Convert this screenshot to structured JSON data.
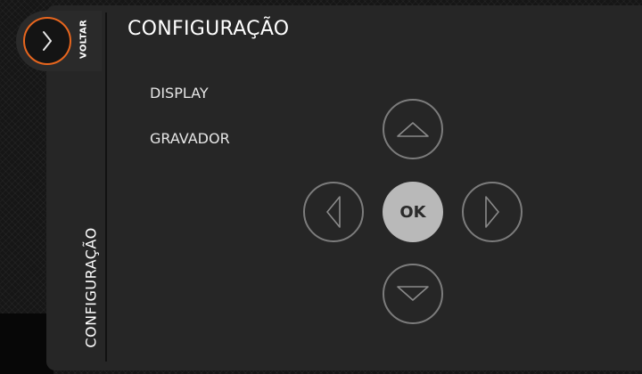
{
  "navigation": {
    "back_icon": "chevron-right-icon",
    "back_label": "VOLTAR",
    "section_label": "CONFIGURAÇÃO"
  },
  "header": {
    "title": "CONFIGURAÇÃO"
  },
  "menu": {
    "items": [
      {
        "label": "DISPLAY"
      },
      {
        "label": "GRAVADOR"
      }
    ]
  },
  "dpad": {
    "up_icon": "triangle-up-icon",
    "left_icon": "triangle-left-icon",
    "right_icon": "triangle-right-icon",
    "down_icon": "triangle-down-icon",
    "ok_label": "OK"
  },
  "colors": {
    "background": "#161616",
    "panel": "#262626",
    "accent": "#e8661e",
    "button_outline": "#7c7c7c",
    "ok_fill": "#b9b9b9",
    "text": "#ffffff"
  }
}
